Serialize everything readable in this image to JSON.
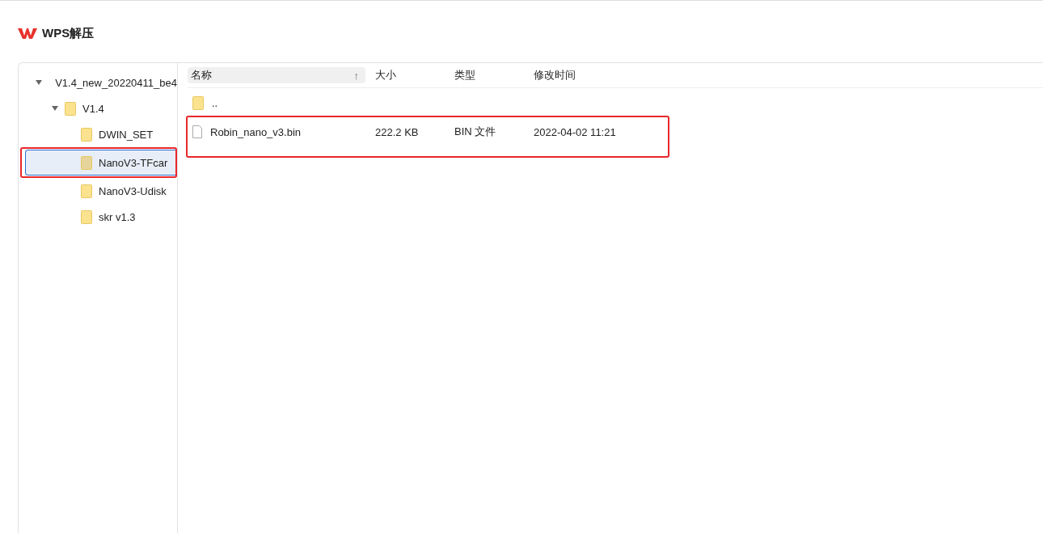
{
  "app": {
    "title": "WPS解压"
  },
  "tree": [
    {
      "label": "V1.4_new_20220411_be4",
      "kind": "archive",
      "expanded": true,
      "selected": false,
      "annotated": false,
      "children": [
        {
          "label": "V1.4",
          "kind": "folder",
          "expanded": true,
          "selected": false,
          "annotated": false,
          "children": [
            {
              "label": "DWIN_SET",
              "kind": "folder",
              "selected": false,
              "annotated": false
            },
            {
              "label": "NanoV3-TFcar",
              "kind": "folder",
              "selected": true,
              "annotated": true
            },
            {
              "label": "NanoV3-Udisk",
              "kind": "folder",
              "selected": false,
              "annotated": false
            },
            {
              "label": "skr v1.3",
              "kind": "folder",
              "selected": false,
              "annotated": false
            }
          ]
        }
      ]
    }
  ],
  "table": {
    "columns": [
      {
        "label": "名称",
        "sort": "↑"
      },
      {
        "label": "大小"
      },
      {
        "label": "类型"
      },
      {
        "label": "修改时间"
      }
    ],
    "rows": [
      {
        "kind": "folder",
        "name": "..",
        "annotated": false
      },
      {
        "kind": "file",
        "name": "Robin_nano_v3.bin",
        "size": "222.2 KB",
        "type": "BIN 文件",
        "modified": "2022-04-02 11:21",
        "annotated": true
      }
    ]
  }
}
